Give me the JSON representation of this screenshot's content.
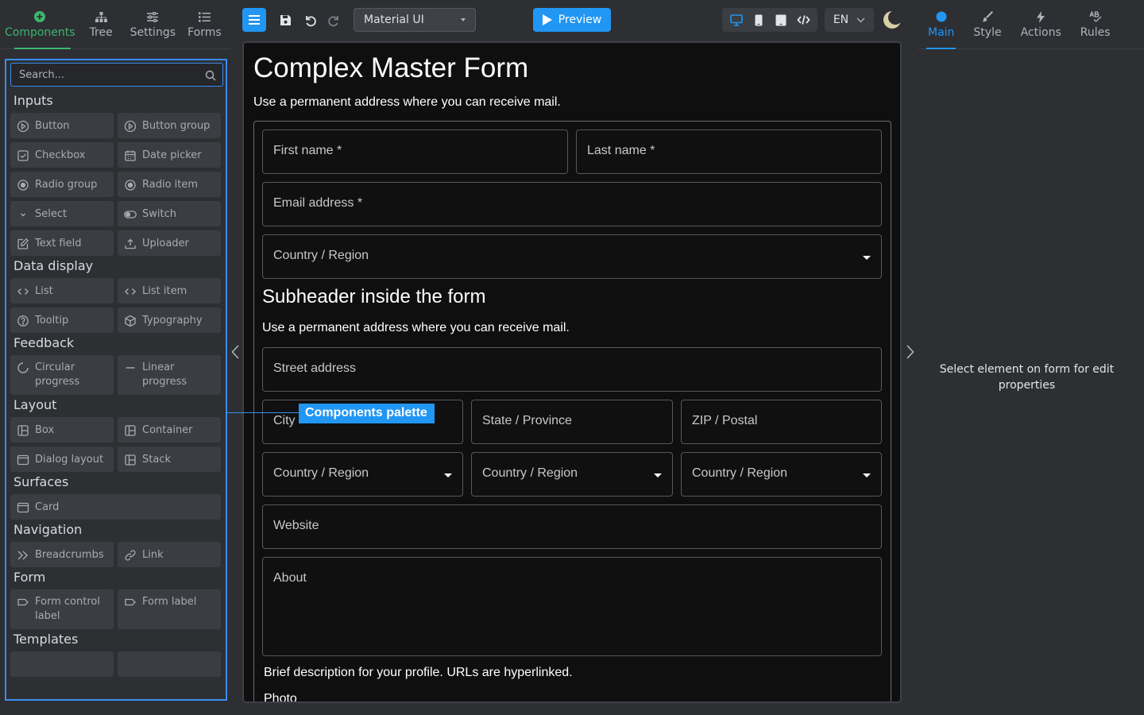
{
  "left_tabs": [
    {
      "label": "Components",
      "icon": "plus-circle-icon",
      "active": true
    },
    {
      "label": "Tree",
      "icon": "tree-icon"
    },
    {
      "label": "Settings",
      "icon": "sliders-icon"
    },
    {
      "label": "Forms",
      "icon": "list-icon"
    }
  ],
  "search": {
    "placeholder": "Search..."
  },
  "categories": {
    "inputs": {
      "title": "Inputs",
      "items": [
        "Button",
        "Button group",
        "Checkbox",
        "Date picker",
        "Radio group",
        "Radio item",
        "Select",
        "Switch",
        "Text field",
        "Uploader"
      ]
    },
    "data_display": {
      "title": "Data display",
      "items": [
        "List",
        "List item",
        "Tooltip",
        "Typography"
      ]
    },
    "feedback": {
      "title": "Feedback",
      "items": [
        "Circular progress",
        "Linear progress"
      ]
    },
    "layout": {
      "title": "Layout",
      "items": [
        "Box",
        "Container",
        "Dialog layout",
        "Stack"
      ]
    },
    "surfaces": {
      "title": "Surfaces",
      "items": [
        "Card"
      ]
    },
    "navigation": {
      "title": "Navigation",
      "items": [
        "Breadcrumbs",
        "Link"
      ]
    },
    "form": {
      "title": "Form",
      "items": [
        "Form control label",
        "Form label"
      ]
    },
    "templates": {
      "title": "Templates"
    }
  },
  "toolbar": {
    "ui_library": "Material UI",
    "preview_label": "Preview",
    "language": "EN",
    "accent": "#2196f3"
  },
  "canvas": {
    "title": "Complex Master Form",
    "description": "Use a permanent address where you can receive mail.",
    "fields": {
      "first_name": "First name *",
      "last_name": "Last name *",
      "email": "Email address *",
      "country": "Country / Region",
      "street": "Street address",
      "city": "City",
      "state": "State / Province",
      "zip": "ZIP / Postal",
      "country_a": "Country / Region",
      "country_b": "Country / Region",
      "country_c": "Country / Region",
      "website": "Website",
      "about": "About"
    },
    "subheader": "Subheader inside the form",
    "sub_description": "Use a permanent address where you can receive mail.",
    "helper_text": "Brief description for your profile. URLs are hyperlinked.",
    "photo_label": "Photo"
  },
  "tooltip": {
    "label": "Components palette"
  },
  "right_tabs": [
    {
      "label": "Main",
      "icon": "dot-icon",
      "active": true
    },
    {
      "label": "Style",
      "icon": "brush-icon"
    },
    {
      "label": "Actions",
      "icon": "bolt-icon"
    },
    {
      "label": "Rules",
      "icon": "spellcheck-icon"
    }
  ],
  "right_message": "Select element on form for edit properties"
}
